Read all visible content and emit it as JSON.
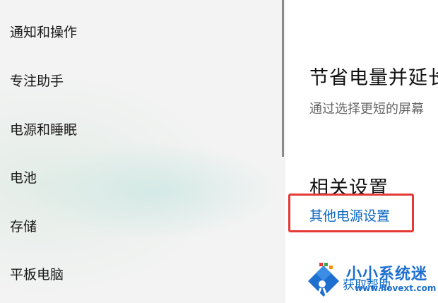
{
  "sidebar": {
    "items": [
      {
        "label": "通知和操作"
      },
      {
        "label": "专注助手"
      },
      {
        "label": "电源和睡眠"
      },
      {
        "label": "电池"
      },
      {
        "label": "存储"
      },
      {
        "label": "平板电脑"
      }
    ]
  },
  "main": {
    "power_saving": {
      "title": "节省电量并延长",
      "description": "通过选择更短的屏幕"
    },
    "related_settings": {
      "title": "相关设置",
      "link": "其他电源设置"
    },
    "help_link": "获取帮助"
  },
  "watermark": {
    "title": "小小系统迷",
    "url": "www.llovext.com"
  },
  "colors": {
    "link": "#0a66c2",
    "highlight": "#e53935"
  }
}
